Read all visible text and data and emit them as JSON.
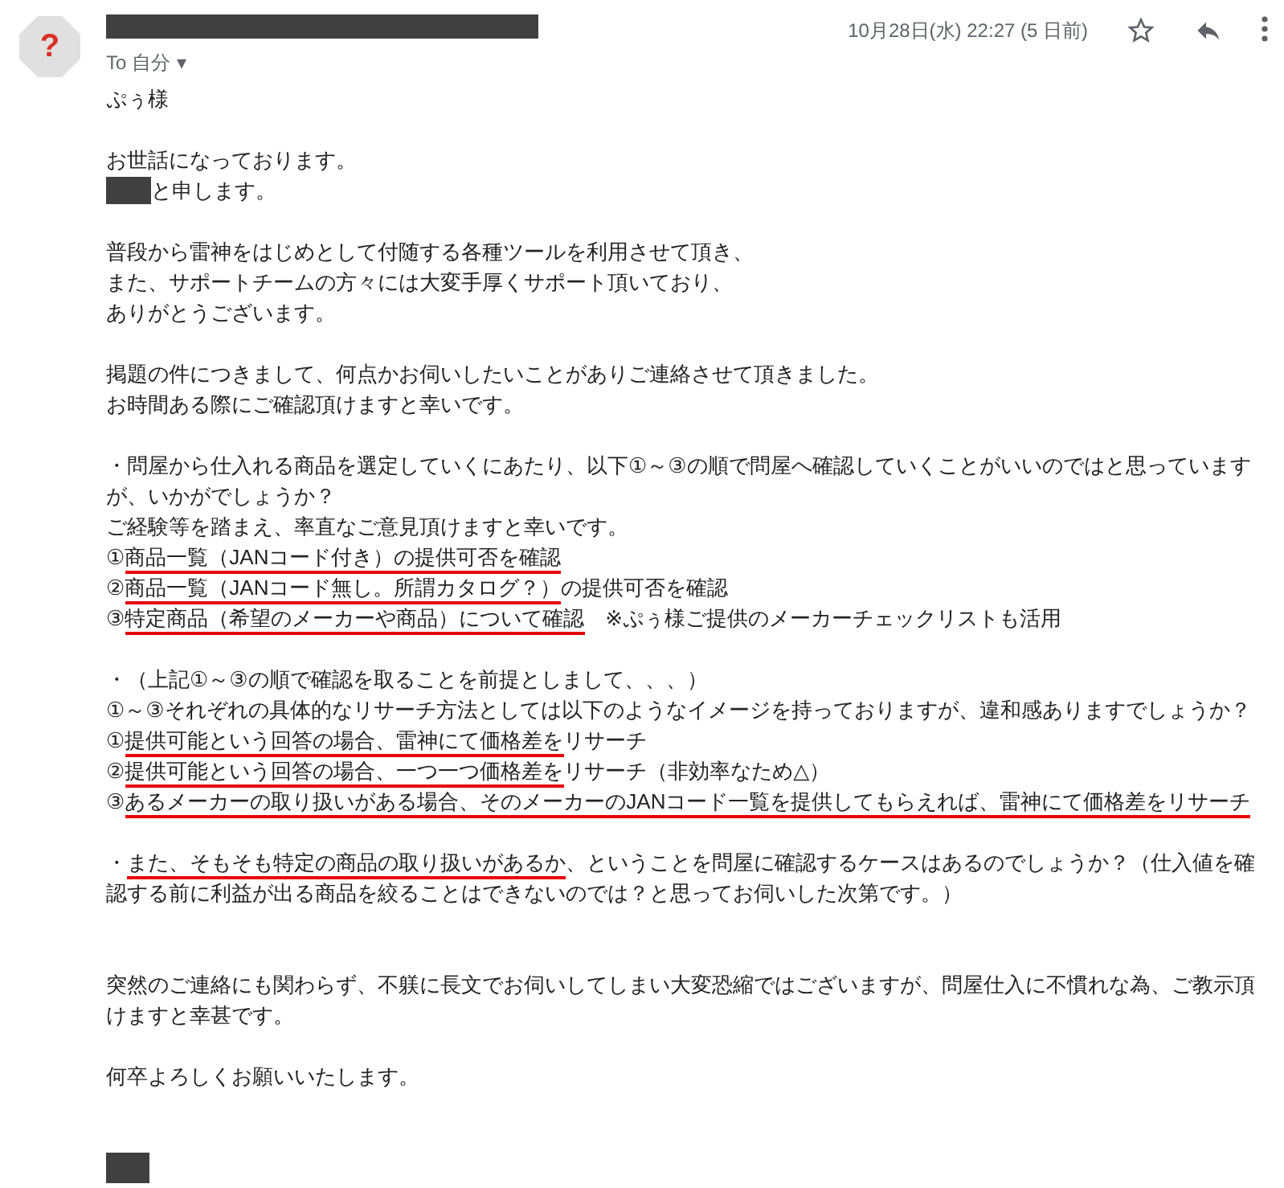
{
  "avatar": {
    "glyph": "?"
  },
  "header": {
    "sender": {
      "kind": "redacted"
    },
    "recipient": "To 自分",
    "recipient_caret": "▾",
    "date": "10月28日(水) 22:27 (5 日前)"
  },
  "body": [
    {
      "kind": "text",
      "segments": [
        {
          "text": "ぷぅ様",
          "underlined": false
        }
      ]
    },
    {
      "kind": "blank"
    },
    {
      "kind": "text",
      "segments": [
        {
          "text": "お世話になっております。",
          "underlined": false
        }
      ]
    },
    {
      "kind": "text",
      "segments": [
        {
          "kind": "redacted"
        },
        {
          "text": "と申します。",
          "underlined": false
        }
      ]
    },
    {
      "kind": "blank"
    },
    {
      "kind": "text",
      "segments": [
        {
          "text": "普段から雷神をはじめとして付随する各種ツールを利用させて頂き、",
          "underlined": false
        }
      ]
    },
    {
      "kind": "text",
      "segments": [
        {
          "text": "また、サポートチームの方々には大変手厚くサポート頂いており、",
          "underlined": false
        }
      ]
    },
    {
      "kind": "text",
      "segments": [
        {
          "text": "ありがとうございます。",
          "underlined": false
        }
      ]
    },
    {
      "kind": "blank"
    },
    {
      "kind": "text",
      "segments": [
        {
          "text": "掲題の件につきまして、何点かお伺いしたいことがありご連絡させて頂きました。",
          "underlined": false
        }
      ]
    },
    {
      "kind": "text",
      "segments": [
        {
          "text": "お時間ある際にご確認頂けますと幸いです。",
          "underlined": false
        }
      ]
    },
    {
      "kind": "blank"
    },
    {
      "kind": "text",
      "segments": [
        {
          "text": "・問屋から仕入れる商品を選定していくにあたり、以下①～③の順で問屋へ確認していくことがいいのではと思っていますが、いかがでしょうか？",
          "underlined": false
        }
      ]
    },
    {
      "kind": "text",
      "segments": [
        {
          "text": "ご経験等を踏まえ、率直なご意見頂けますと幸いです。",
          "underlined": false
        }
      ]
    },
    {
      "kind": "text",
      "segments": [
        {
          "text": "①",
          "underlined": false
        },
        {
          "text": "商品一覧（JANコード付き）の提供可否を確認",
          "underlined": true
        }
      ]
    },
    {
      "kind": "text",
      "segments": [
        {
          "text": "②",
          "underlined": false
        },
        {
          "text": "商品一覧（JANコード無し。所謂カタログ？）",
          "underlined": true
        },
        {
          "text": "の提供可否を確認",
          "underlined": false
        }
      ]
    },
    {
      "kind": "text",
      "segments": [
        {
          "text": "③",
          "underlined": false
        },
        {
          "text": "特定商品（希望のメーカーや商品）について確認",
          "underlined": true
        },
        {
          "text": "　※ぷぅ様ご提供のメーカーチェックリストも活用",
          "underlined": false
        }
      ]
    },
    {
      "kind": "blank"
    },
    {
      "kind": "text",
      "segments": [
        {
          "text": "・（上記①～③の順で確認を取ることを前提としまして、、、）",
          "underlined": false
        }
      ]
    },
    {
      "kind": "text",
      "segments": [
        {
          "text": "①～③それぞれの具体的なリサーチ方法としては以下のようなイメージを持っておりますが、違和感ありますでしょうか？",
          "underlined": false
        }
      ]
    },
    {
      "kind": "text",
      "segments": [
        {
          "text": "①",
          "underlined": false
        },
        {
          "text": "提供可能という回答の場合、雷神にて価格差を",
          "underlined": true
        },
        {
          "text": "リサーチ",
          "underlined": false
        }
      ]
    },
    {
      "kind": "text",
      "segments": [
        {
          "text": "②",
          "underlined": false
        },
        {
          "text": "提供可能という回答の場合、一つ一つ価格差を",
          "underlined": true
        },
        {
          "text": "リサーチ（非効率なため△）",
          "underlined": false
        }
      ]
    },
    {
      "kind": "text",
      "segments": [
        {
          "text": "③",
          "underlined": false
        },
        {
          "text": "あるメーカーの取り扱いがある場合、そのメーカーのJANコード一覧を提供してもらえれば、雷神にて価格差をリサーチ",
          "underlined": true
        }
      ]
    },
    {
      "kind": "blank"
    },
    {
      "kind": "text",
      "segments": [
        {
          "text": "・",
          "underlined": false
        },
        {
          "text": "また、そもそも特定の商品の取り扱いがあるか",
          "underlined": true
        },
        {
          "text": "、ということを問屋に確認するケースはあるのでしょうか？（仕入値を確認する前に利益が出る商品を絞ることはできないのでは？と思ってお伺いした次第です。）",
          "underlined": false
        }
      ]
    },
    {
      "kind": "blank"
    },
    {
      "kind": "blank"
    },
    {
      "kind": "text",
      "segments": [
        {
          "text": "突然のご連絡にも関わらず、不躾に長文でお伺いしてしまい大変恐縮ではございますが、問屋仕入に不慣れな為、ご教示頂けますと幸甚です。",
          "underlined": false
        }
      ]
    },
    {
      "kind": "blank"
    },
    {
      "kind": "text",
      "segments": [
        {
          "text": "何卒よろしくお願いいたします。",
          "underlined": false
        }
      ]
    },
    {
      "kind": "blank"
    },
    {
      "kind": "blank"
    },
    {
      "kind": "signature",
      "segments": [
        {
          "kind": "redacted"
        }
      ]
    }
  ]
}
